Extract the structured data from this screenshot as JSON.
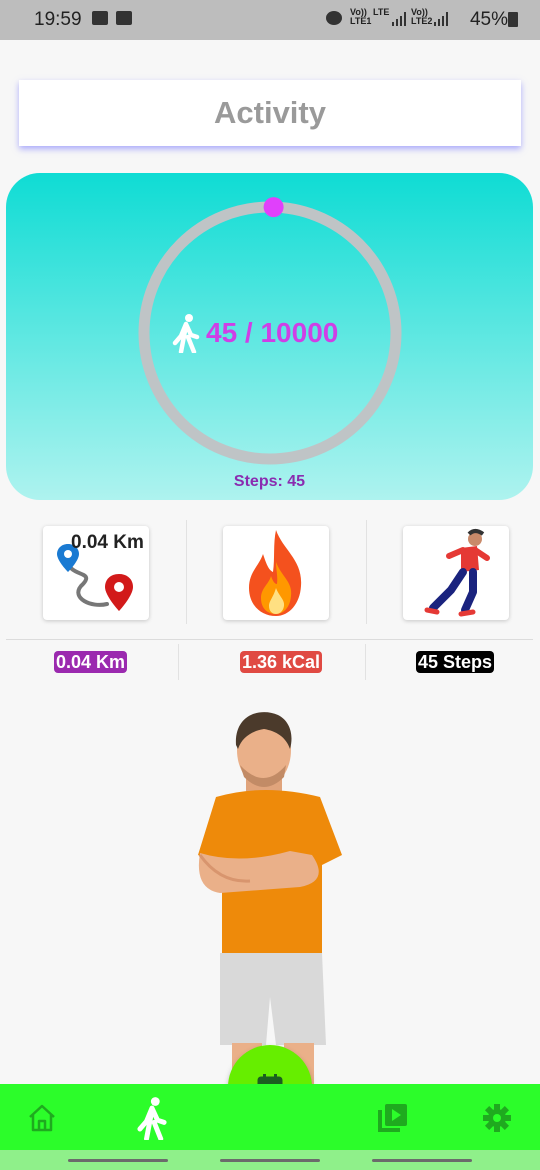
{
  "status_bar": {
    "time": "19:59",
    "lte1_top": "Vo))",
    "lte1_bottom": "LTE1",
    "lte_mid": "LTE",
    "lte2_top": "Vo))",
    "lte2_bottom": "LTE2",
    "battery": "45%"
  },
  "header": {
    "title": "Activity"
  },
  "progress": {
    "steps": 45,
    "goal": 10000,
    "label": "45 / 10000",
    "steps_caption": "Steps:  45",
    "ring_color": "#bfc4c6",
    "indicator_color": "#e040fb"
  },
  "stats": {
    "distance_card_label": "0.04 Km",
    "distance_pill": "0.04 Km",
    "calories_pill": "1.36 kCal",
    "steps_pill": "45 Steps"
  },
  "icons": {
    "walker": "walking-person-icon",
    "route": "route-map-icon",
    "fire": "fire-icon",
    "runner": "runner-icon",
    "home": "home-icon",
    "activity": "walking-icon",
    "calendar": "calendar-icon",
    "video": "video-library-icon",
    "settings": "gear-icon"
  },
  "colors": {
    "accent_purple": "#cf3fe6",
    "bottom_nav": "#2cfd2a",
    "fab": "#66ee00"
  }
}
